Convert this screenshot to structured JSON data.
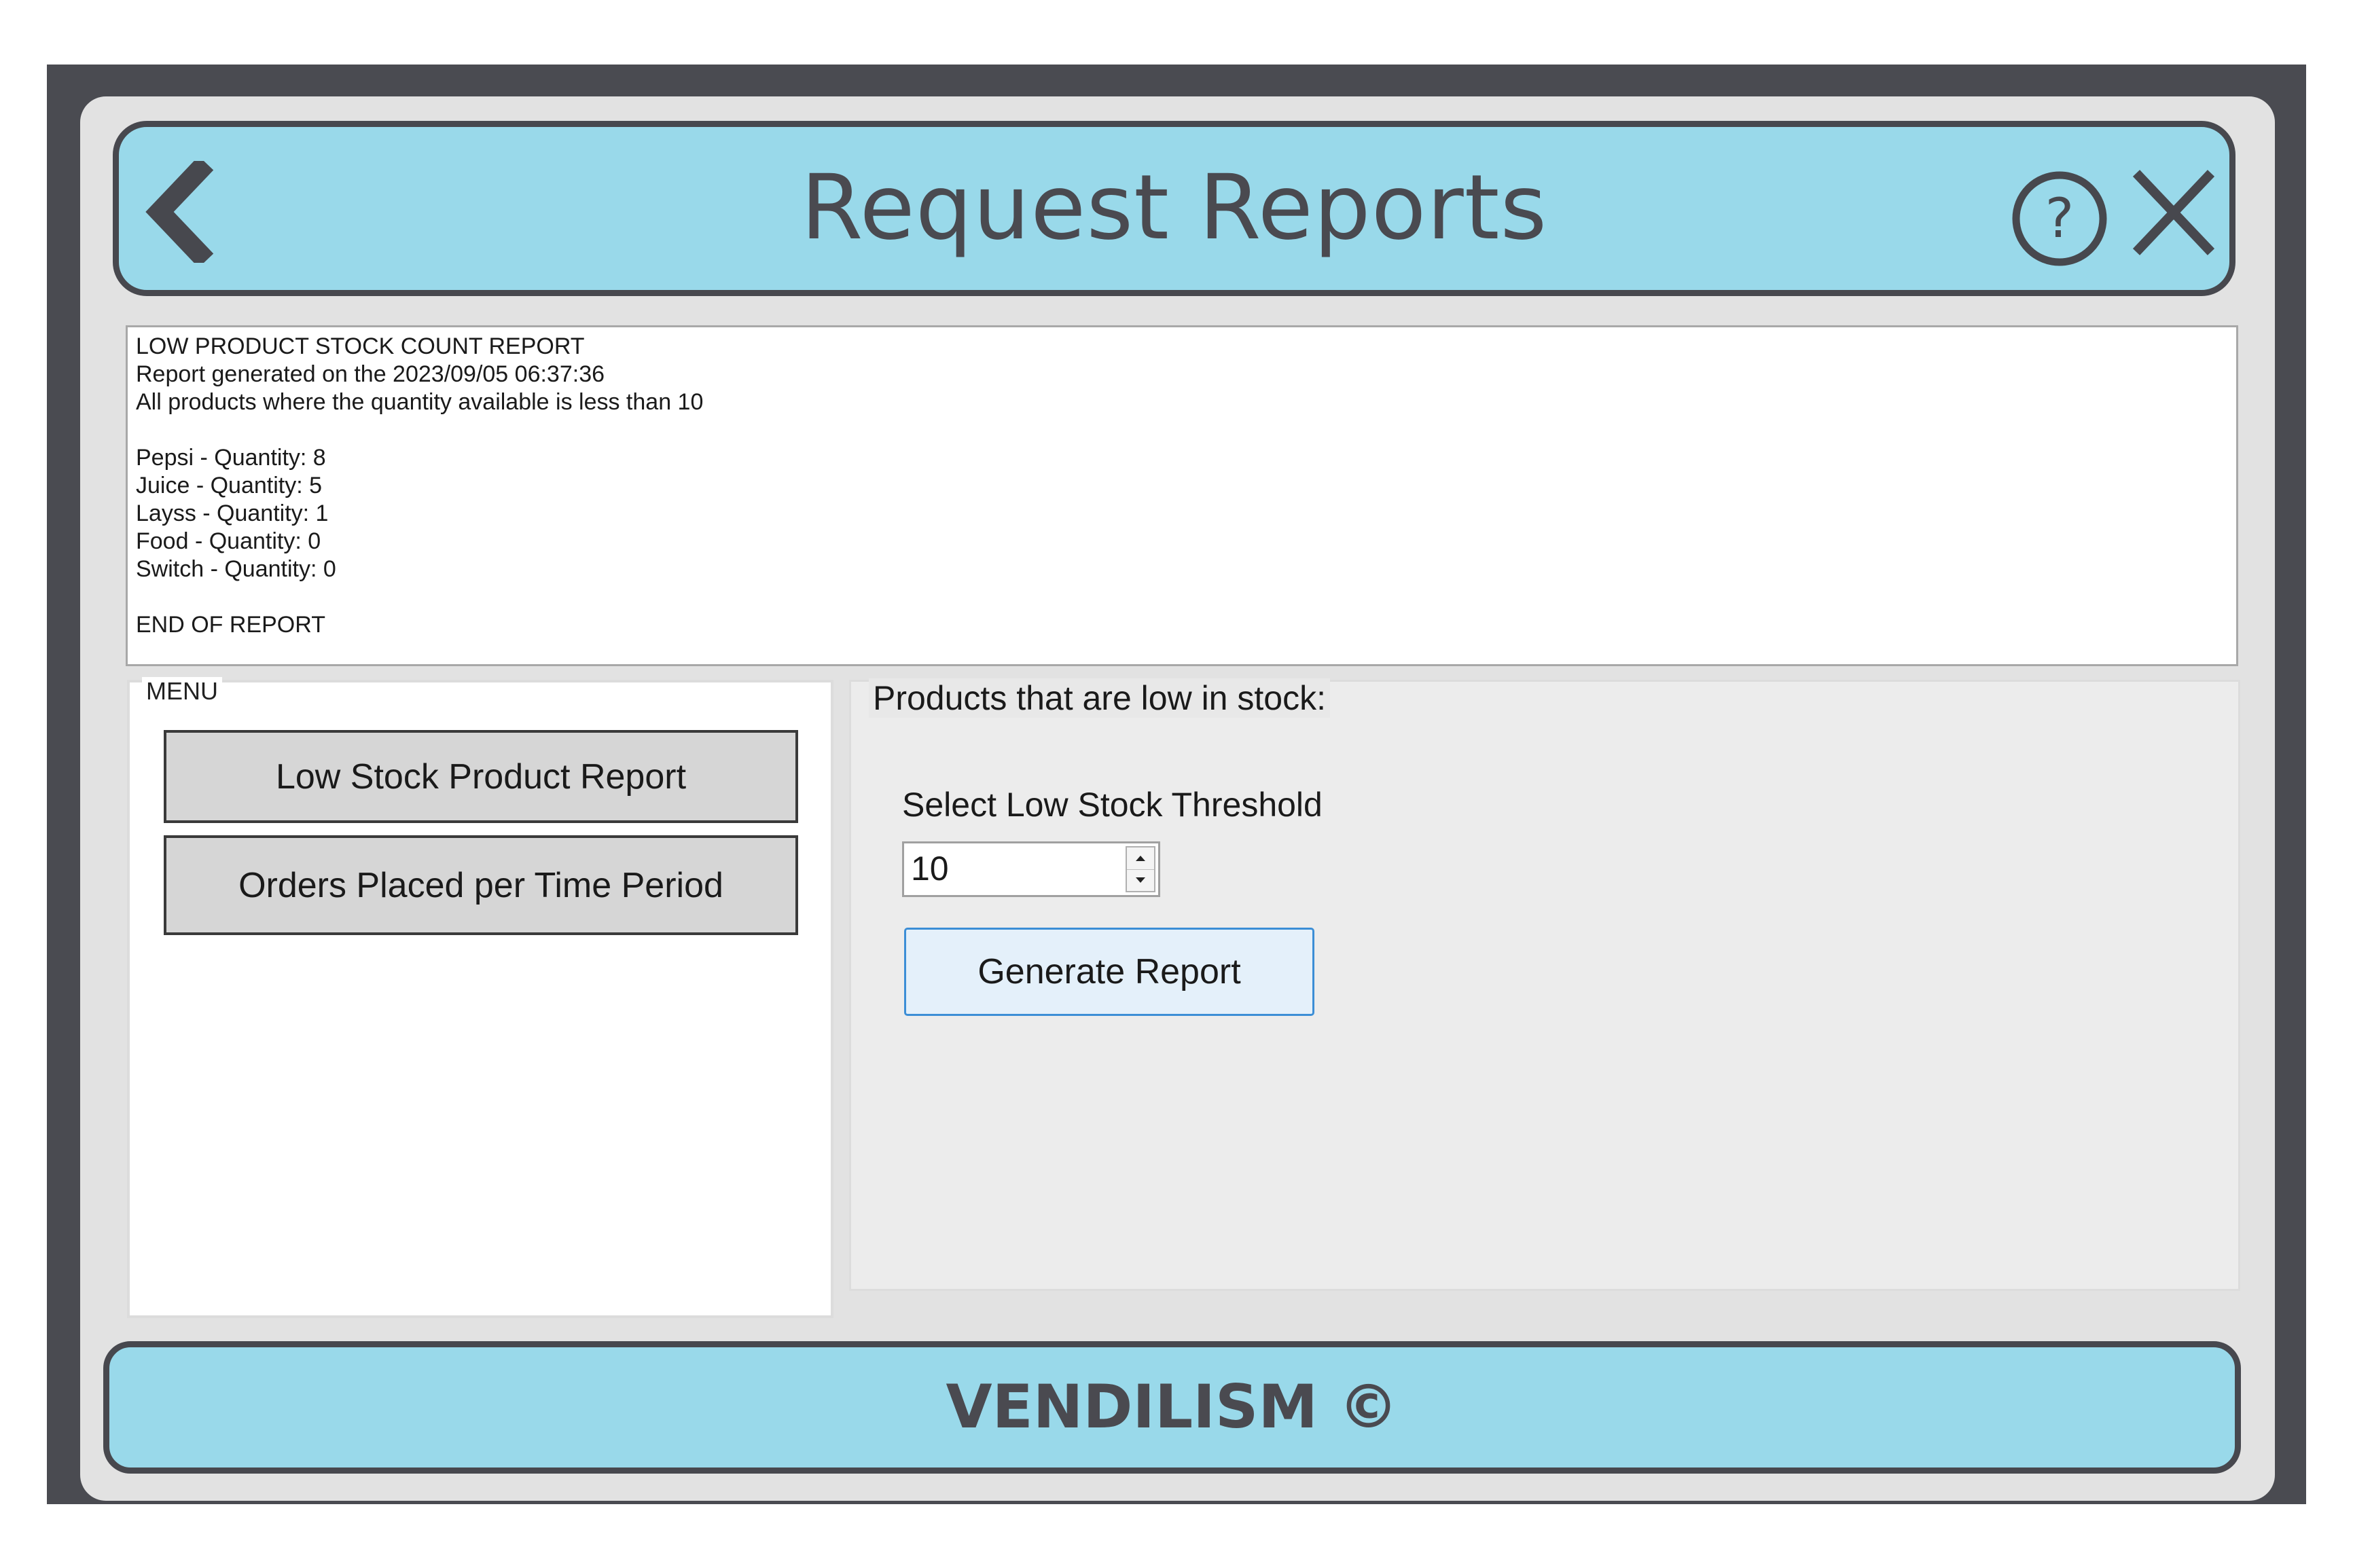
{
  "header": {
    "title": "Request Reports",
    "back_icon": "chevron-left-icon",
    "help_icon": "question-circle-icon",
    "close_icon": "close-icon",
    "bar_color": "#99d9ea"
  },
  "report": {
    "lines": [
      "LOW PRODUCT STOCK COUNT REPORT",
      "Report generated on the 2023/09/05 06:37:36",
      "All products where the quantity available is less than 10",
      "",
      "Pepsi - Quantity: 8",
      "Juice - Quantity: 5",
      "Layss - Quantity: 1",
      "Food - Quantity: 0",
      "Switch - Quantity: 0",
      "",
      "END OF REPORT"
    ]
  },
  "menu": {
    "caption": "MENU",
    "items": [
      {
        "label": "Low Stock Product Report"
      },
      {
        "label": "Orders Placed per Time Period"
      }
    ]
  },
  "options": {
    "caption": "Products that are low in stock:",
    "threshold_label": "Select Low Stock Threshold",
    "threshold_value": "10",
    "generate_label": "Generate Report",
    "button_accent": "#3c8ed6"
  },
  "footer": {
    "text": "VENDILISM ©"
  }
}
